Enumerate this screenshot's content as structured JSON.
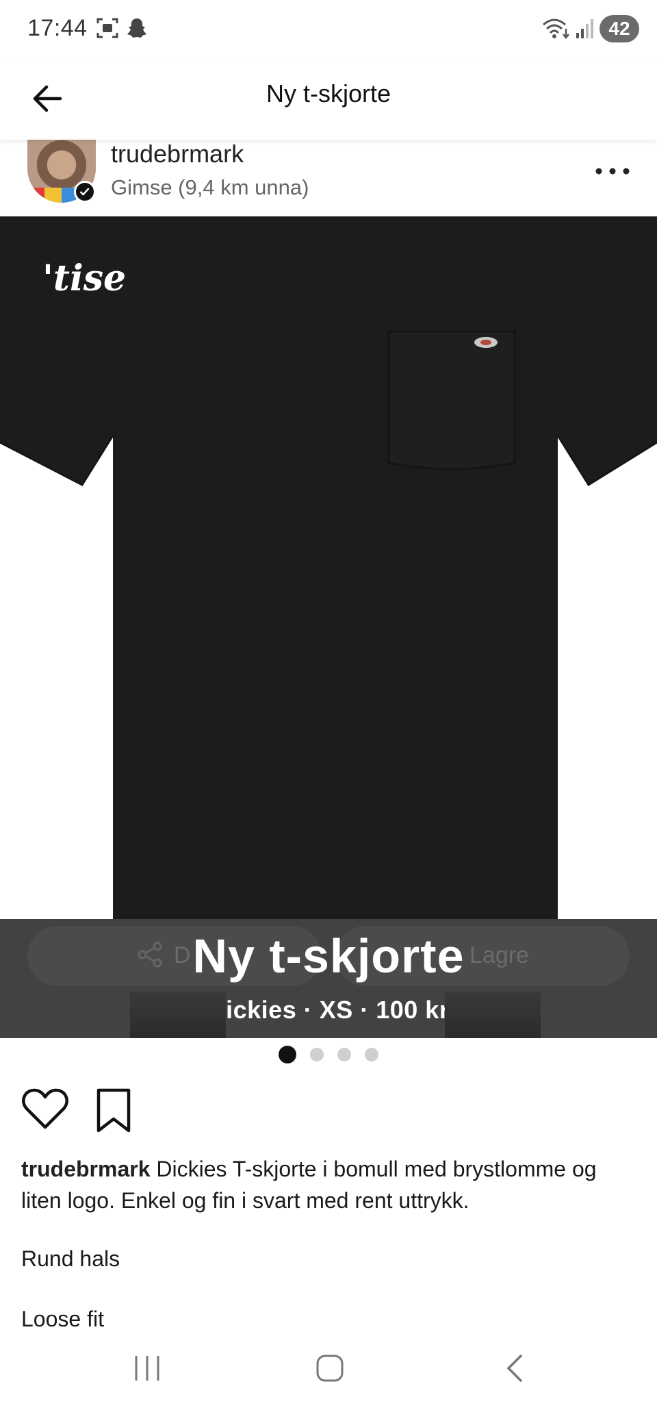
{
  "status_bar": {
    "time": "17:44",
    "battery": "42",
    "icons": [
      "screenshot-icon",
      "snapchat-icon",
      "wifi-icon",
      "signal-icon"
    ]
  },
  "header": {
    "title": "Ny t-skjorte",
    "back_icon": "arrow-left-icon"
  },
  "seller": {
    "username": "trudebrmark",
    "location": "Gimse (9,4 km unna)",
    "more_icon": "more-horizontal-icon"
  },
  "image": {
    "watermark": "'tise",
    "overlay_title": "Ny t-skjorte",
    "overlay_subtitle": "Dickies · XS · 100 kr",
    "ghost_share_label": "D",
    "ghost_save_label": "Lagre",
    "page_count": 4,
    "active_page": 1
  },
  "actions": {
    "like_icon": "heart-icon",
    "save_icon": "bookmark-icon"
  },
  "description": {
    "username": "trudebrmark",
    "text": " Dickies T-skjorte i bomull med brystlomme og liten logo. Enkel og fin i svart med rent uttrykk.",
    "line2": "Rund hals",
    "line3": "Loose fit"
  },
  "colors": {
    "shirt": "#1c1c1c",
    "overlay": "#3a3a3a",
    "active_dot": "#111111",
    "inactive_dot": "#cfcfcf"
  },
  "nav": {
    "icons": [
      "recent-apps-icon",
      "home-icon",
      "back-icon"
    ]
  }
}
